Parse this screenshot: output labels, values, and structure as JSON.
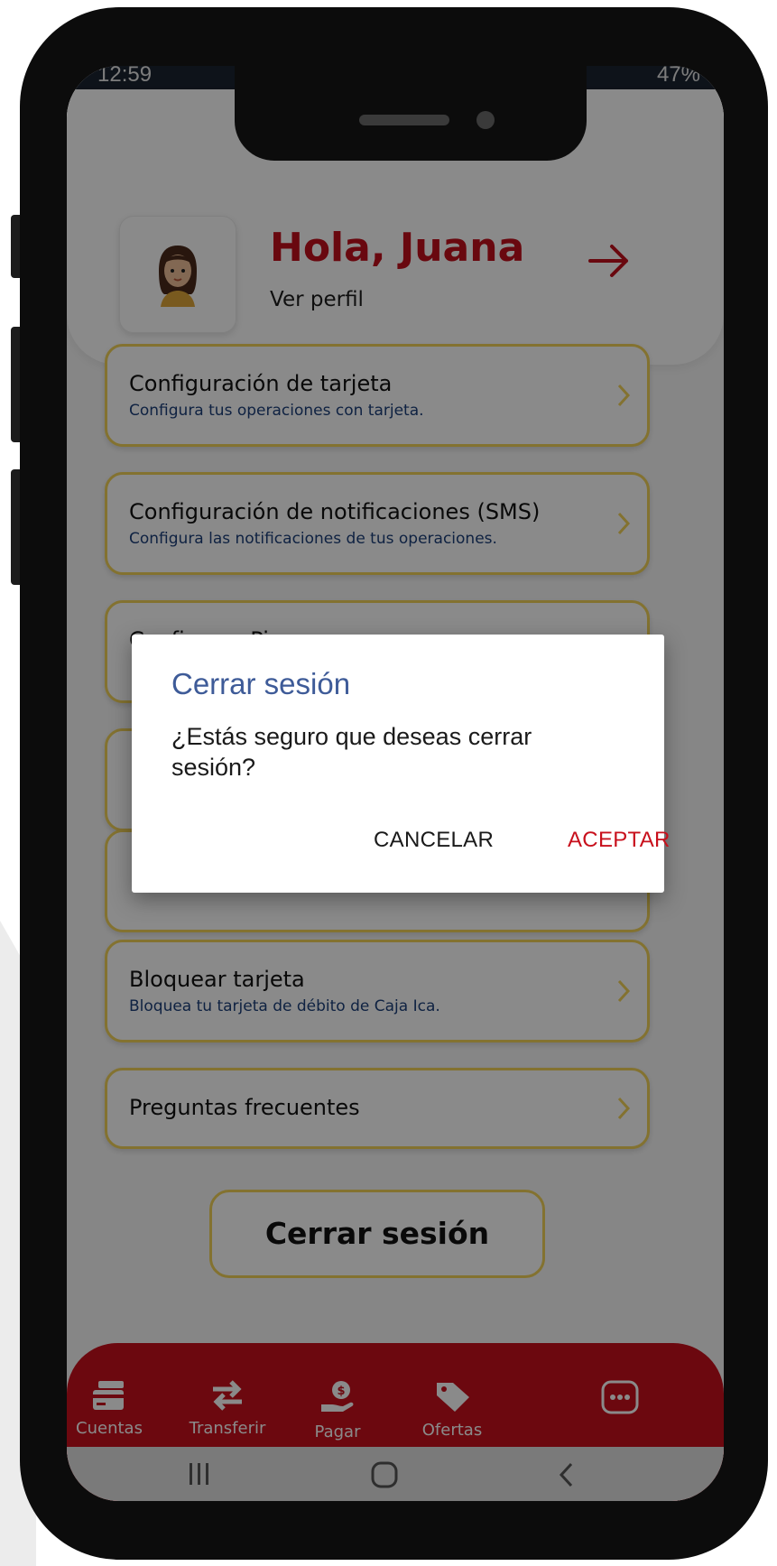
{
  "status_bar": {
    "time": "12:59",
    "right": "47%"
  },
  "header": {
    "greeting": "Hola, Juana",
    "profile_link": "Ver perfil"
  },
  "menu": [
    {
      "title": "Configuración de tarjeta",
      "subtitle": "Configura tus operaciones con tarjeta."
    },
    {
      "title": "Configuración de notificaciones (SMS)",
      "subtitle": "Configura las notificaciones de tus operaciones."
    },
    {
      "title": "Configurar Pin",
      "subtitle": ""
    },
    {
      "title": "",
      "subtitle": ""
    },
    {
      "title": "",
      "subtitle": ""
    },
    {
      "title": "Bloquear tarjeta",
      "subtitle": "Bloquea tu tarjeta de débito de Caja Ica."
    },
    {
      "title": "Preguntas frecuentes",
      "subtitle": ""
    }
  ],
  "logout_button": "Cerrar sesión",
  "bottom_nav": [
    {
      "label": "Cuentas",
      "icon": "card-icon"
    },
    {
      "label": "Transferir",
      "icon": "transfer-arrows-icon"
    },
    {
      "label": "Pagar",
      "icon": "pay-hand-coin-icon"
    },
    {
      "label": "Ofertas",
      "icon": "tag-icon"
    },
    {
      "label": "",
      "icon": "more-icon"
    }
  ],
  "dialog": {
    "title": "Cerrar sesión",
    "message": "¿Estás seguro que deseas cerrar sesión?",
    "cancel": "CANCELAR",
    "accept": "ACEPTAR"
  },
  "colors": {
    "brand_red": "#c8101c",
    "card_border": "#f3d25a",
    "dialog_title": "#3e5b98"
  }
}
